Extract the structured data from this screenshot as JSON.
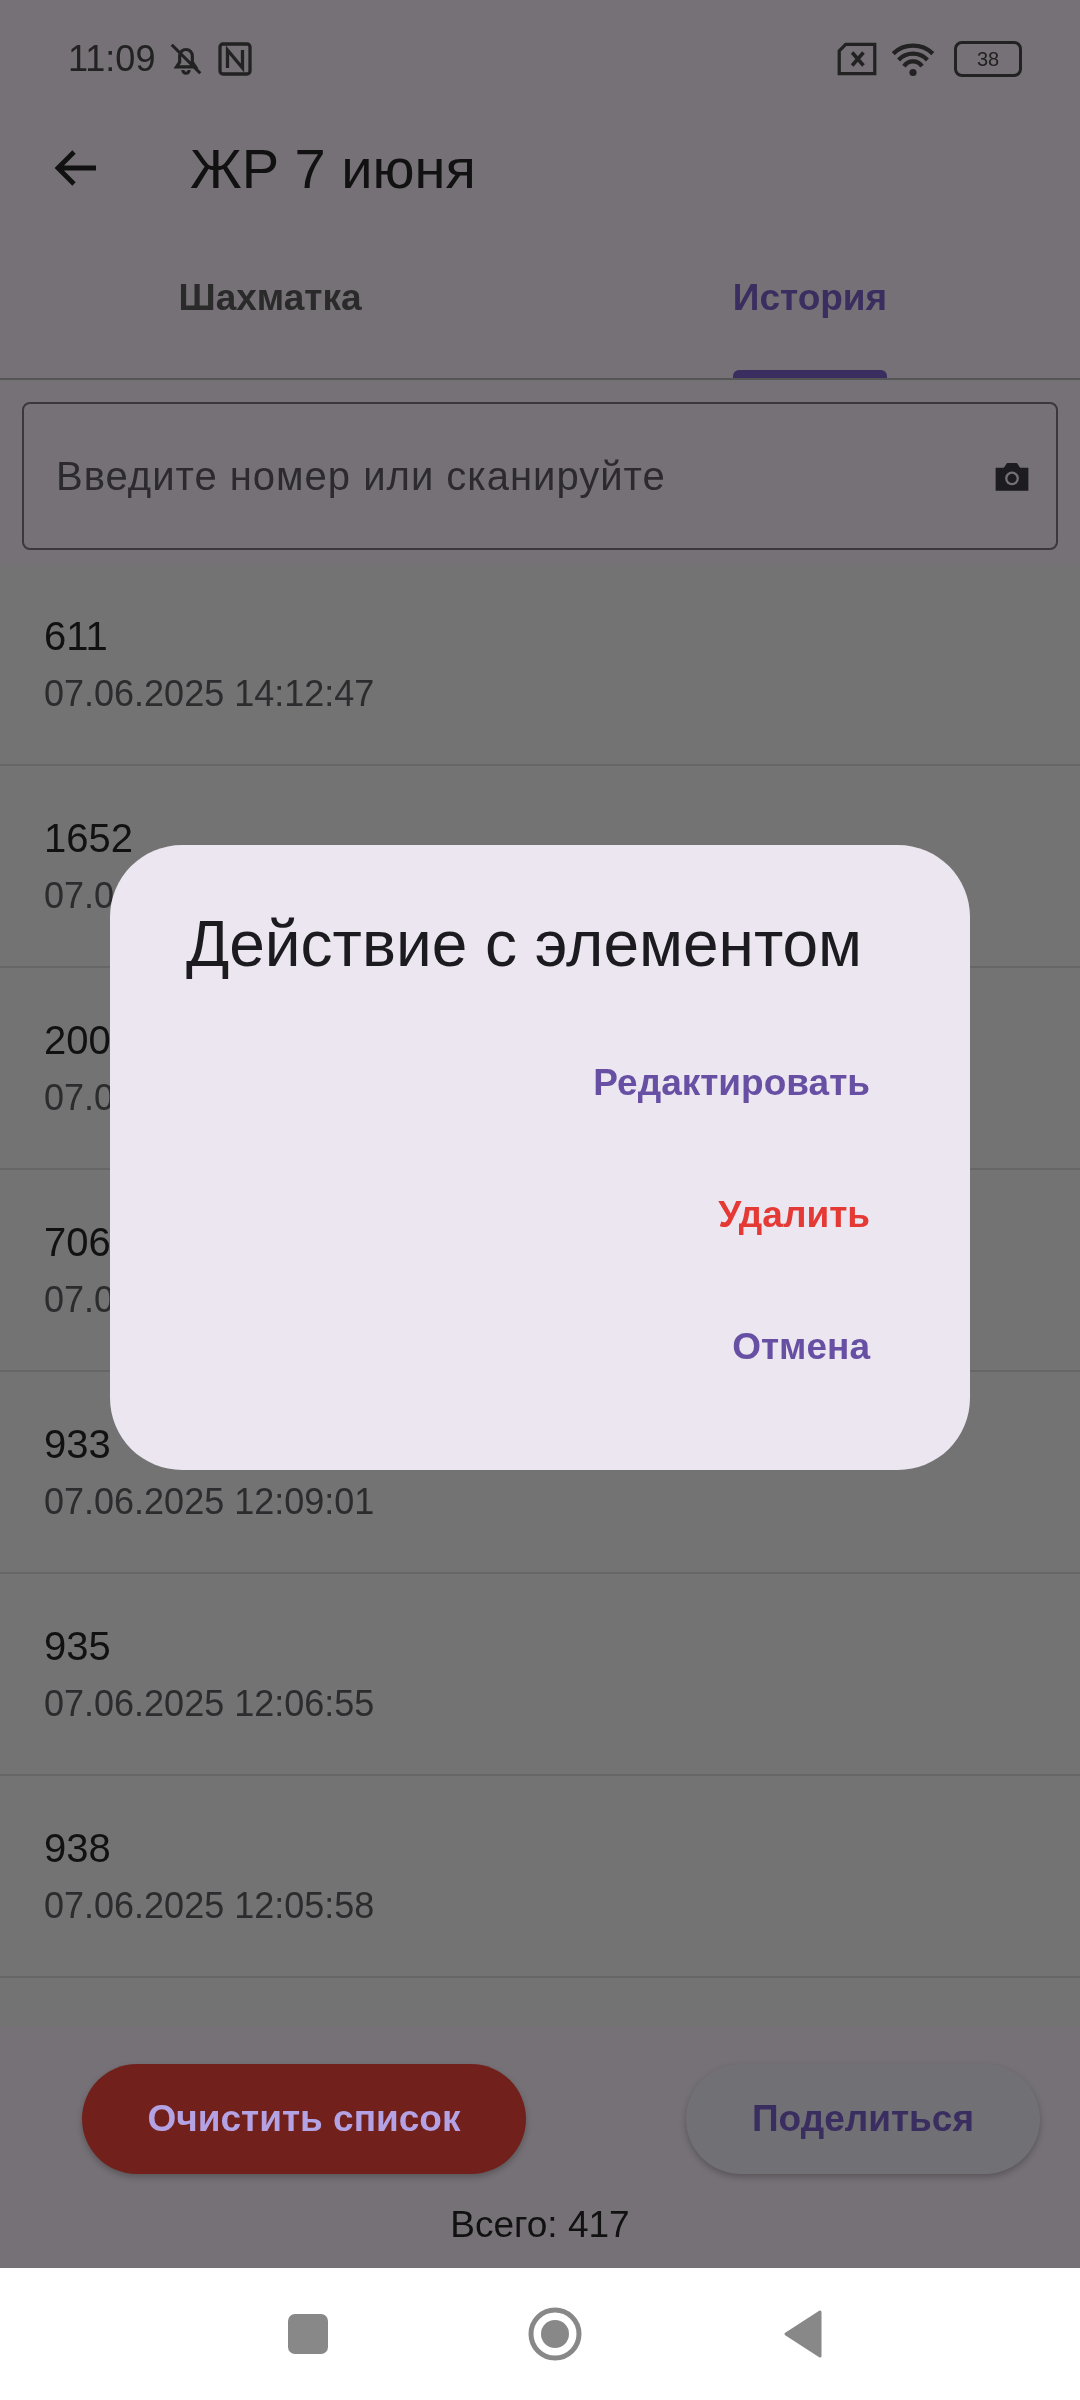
{
  "status_bar": {
    "time": "11:09",
    "battery": "38"
  },
  "app_bar": {
    "title": "ЖР 7 июня"
  },
  "tabs": [
    {
      "label": "Шахматка",
      "selected": false
    },
    {
      "label": "История",
      "selected": true
    }
  ],
  "search": {
    "placeholder": "Введите номер или сканируйте"
  },
  "rows": [
    {
      "number": "611",
      "time": "07.06.2025 14:12:47"
    },
    {
      "number": "1652",
      "time": "07.0"
    },
    {
      "number": "200",
      "time": "07.0"
    },
    {
      "number": "706",
      "time": "07.0"
    },
    {
      "number": "933",
      "time": "07.06.2025 12:09:01"
    },
    {
      "number": "935",
      "time": "07.06.2025 12:06:55"
    },
    {
      "number": "938",
      "time": "07.06.2025 12:05:58"
    }
  ],
  "buttons": [
    {
      "label": "Очистить список",
      "kind": "danger"
    },
    {
      "label": "Поделиться",
      "kind": "tonal"
    }
  ],
  "total": "Всего: 417",
  "dialog": {
    "title": "Действие с элементом",
    "actions": [
      {
        "label": "Редактировать",
        "kind": "normal"
      },
      {
        "label": "Удалить",
        "kind": "danger"
      },
      {
        "label": "Отмена",
        "kind": "normal"
      }
    ]
  }
}
